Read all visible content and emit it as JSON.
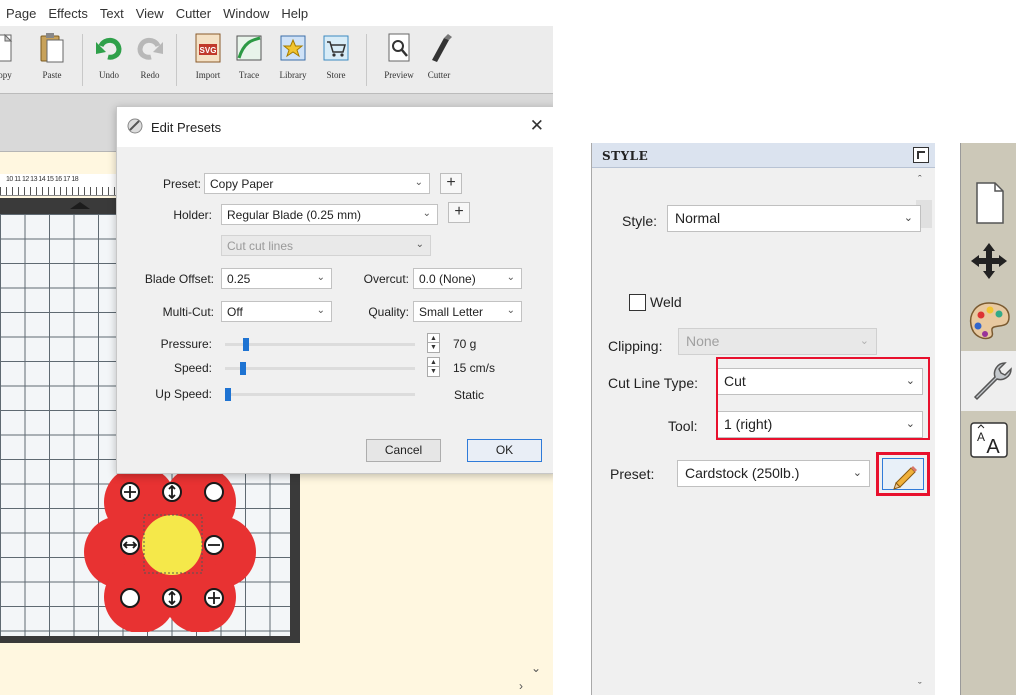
{
  "menubar": {
    "items": [
      "Page",
      "Effects",
      "Text",
      "View",
      "Cutter",
      "Window",
      "Help"
    ]
  },
  "toolbar": {
    "buttons": [
      {
        "label": "Copy",
        "icon": "copy-icon"
      },
      {
        "label": "Paste",
        "icon": "paste-icon"
      },
      {
        "label": "Undo",
        "icon": "undo-icon"
      },
      {
        "label": "Redo",
        "icon": "redo-icon"
      },
      {
        "label": "Import",
        "icon": "svg-import-icon"
      },
      {
        "label": "Trace",
        "icon": "trace-icon"
      },
      {
        "label": "Library",
        "icon": "library-icon"
      },
      {
        "label": "Store",
        "icon": "store-cart-icon"
      },
      {
        "label": "Preview",
        "icon": "preview-magnifier-icon"
      },
      {
        "label": "Cutter",
        "icon": "cutter-blade-icon"
      }
    ]
  },
  "ruler": {
    "numbers": "10 11 12 13 14 15 16 17 18"
  },
  "dialog": {
    "title": "Edit Presets",
    "preset_label": "Preset:",
    "preset_value": "Copy Paper",
    "holder_label": "Holder:",
    "holder_value": "Regular Blade (0.25 mm)",
    "cut_mode_value": "Cut cut lines",
    "blade_offset_label": "Blade Offset:",
    "blade_offset_value": "0.25",
    "overcut_label": "Overcut:",
    "overcut_value": "0.0 (None)",
    "multicut_label": "Multi-Cut:",
    "multicut_value": "Off",
    "quality_label": "Quality:",
    "quality_value": "Small Letter",
    "pressure_label": "Pressure:",
    "pressure_value": "70 g",
    "pressure_level": 0.1,
    "speed_label": "Speed:",
    "speed_value": "15 cm/s",
    "speed_level": 0.08,
    "upspeed_label": "Up Speed:",
    "upspeed_value": "Static",
    "upspeed_level": 0.0,
    "cancel_label": "Cancel",
    "ok_label": "OK"
  },
  "style_panel": {
    "title": "STYLE",
    "style_label": "Style:",
    "style_value": "Normal",
    "weld_label": "Weld",
    "weld_checked": false,
    "clipping_label": "Clipping:",
    "clipping_value": "None",
    "cut_line_type_label": "Cut Line Type:",
    "cut_line_type_value": "Cut",
    "tool_label": "Tool:",
    "tool_value": "1 (right)",
    "preset_label": "Preset:",
    "preset_value": "Cardstock (250lb.)",
    "highlight_color": "#e8102d"
  },
  "side_tabs": [
    {
      "icon": "page-icon"
    },
    {
      "icon": "move-arrows-icon"
    },
    {
      "icon": "palette-icon"
    },
    {
      "icon": "wrench-icon",
      "active": true
    },
    {
      "icon": "text-size-icon"
    }
  ]
}
